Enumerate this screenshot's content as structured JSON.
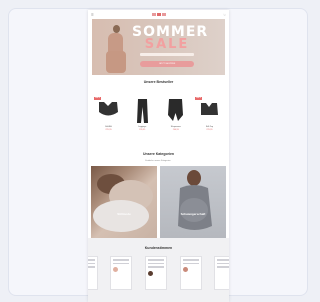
{
  "hero": {
    "title": "SOMMER",
    "sale": "SALE",
    "button": "JETZT SHOPPEN"
  },
  "bestseller": {
    "title": "Unsere Bestseller",
    "products": [
      {
        "badge": "SALE",
        "name": "Still-BH",
        "price": "€29,95"
      },
      {
        "badge": "",
        "name": "Leggings",
        "price": "€39,95"
      },
      {
        "badge": "",
        "name": "Shapewear",
        "price": "€44,95"
      },
      {
        "badge": "SALE",
        "name": "Still-Top",
        "price": "€29,95"
      }
    ]
  },
  "categories": {
    "title": "Unsere Kategorien",
    "subtitle": "Entdecke unsere Kategorien",
    "items": [
      {
        "label": "Stillmode"
      },
      {
        "label": "Schwangerschaft"
      }
    ]
  },
  "reviews": {
    "title": "Kundenstimmen"
  },
  "colors": {
    "accent": "#e89c9c",
    "sale": "#e86a6a",
    "background": "#eef0f6"
  }
}
